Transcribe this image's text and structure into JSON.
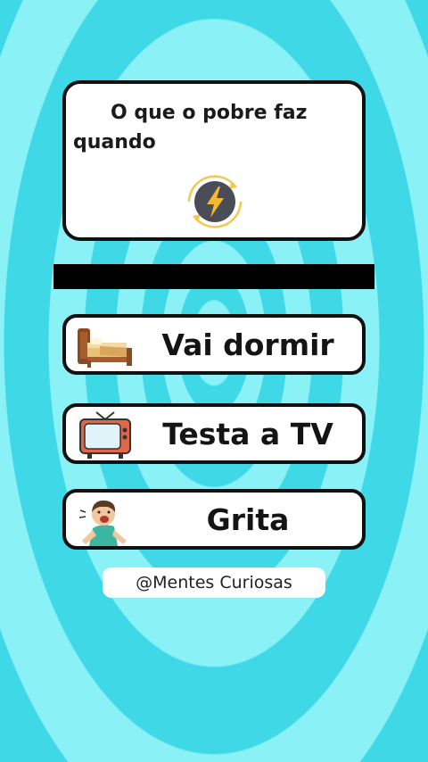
{
  "question": {
    "text": "O que o pobre faz quando",
    "badge_icon": "lightning-icon"
  },
  "options": [
    {
      "label": "Vai dormir",
      "icon": "bed-icon"
    },
    {
      "label": "Testa a TV",
      "icon": "tv-icon"
    },
    {
      "label": "Grita",
      "icon": "shouting-boy-icon"
    }
  ],
  "credit": {
    "text": "@Mentes Curiosas"
  },
  "colors": {
    "background": "#3ed8e6",
    "background_light": "#8af1f7",
    "card_fill": "#ffffff",
    "card_border": "#111111",
    "badge_ring": "#f2c94c",
    "badge_fill": "#4a4d55"
  }
}
